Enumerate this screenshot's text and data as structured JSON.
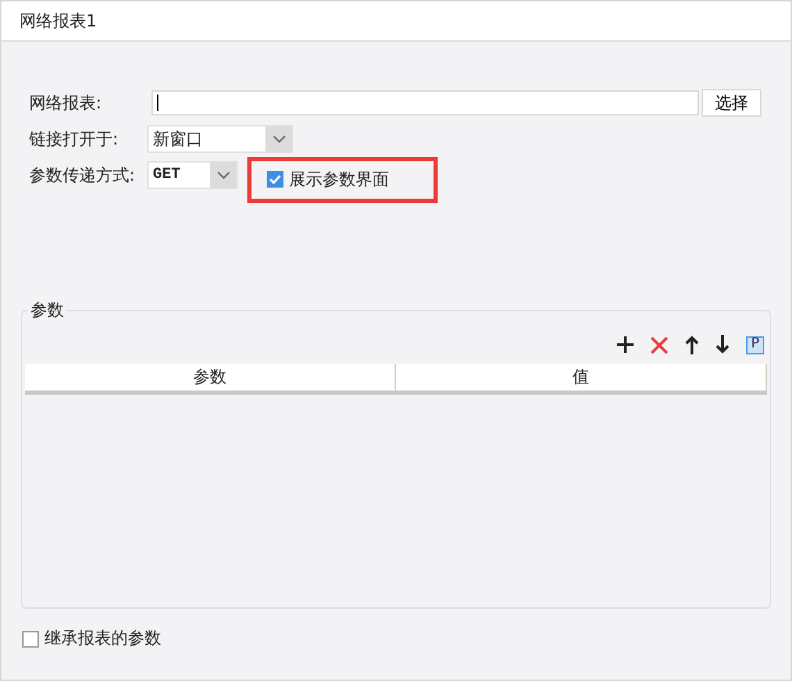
{
  "tab": {
    "title": "网络报表1"
  },
  "form": {
    "report_label": "网络报表:",
    "choose_button": "选择",
    "open_label": "链接打开于:",
    "open_value": "新窗口",
    "method_label": "参数传递方式:",
    "method_value": "GET",
    "show_params": {
      "label": "展示参数界面",
      "checked": true,
      "highlighted": true
    }
  },
  "params": {
    "title": "参数",
    "toolbar": [
      {
        "kind": "add"
      },
      {
        "kind": "delete"
      },
      {
        "kind": "up"
      },
      {
        "kind": "down"
      },
      {
        "kind": "letter",
        "text": "P"
      }
    ],
    "columns": [
      "参数",
      "值"
    ]
  },
  "inherit": {
    "label": "继承报表的参数",
    "checked": false
  }
}
